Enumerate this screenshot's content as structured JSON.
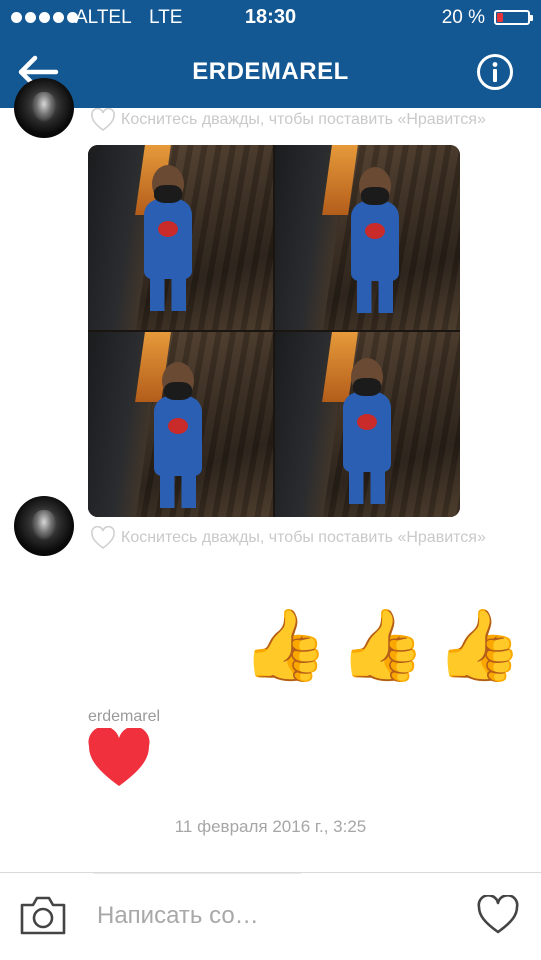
{
  "status_bar": {
    "carrier": "ALTEL",
    "network": "LTE",
    "time": "18:30",
    "battery_percent": "20 %",
    "battery_level": 0.2
  },
  "header": {
    "title": "ERDEMAREL",
    "back_icon": "arrow-left-icon",
    "info_icon": "info-circle-icon"
  },
  "messages": {
    "like_hint": "Коснитесь дважды, чтобы поставить «Нравится»",
    "reaction_emoji": [
      "👍",
      "👍",
      "👍"
    ],
    "sender_name": "erdemarel",
    "heart_icon": "heart-filled-icon",
    "timestamp": "11 февраля 2016 г., 3:25"
  },
  "composer": {
    "camera_icon": "camera-icon",
    "placeholder": "Написать со…",
    "value": "",
    "like_icon": "heart-outline-icon"
  },
  "colors": {
    "header_bg": "#135893",
    "heart_red": "#f0313d",
    "battery_red": "#e8323c"
  }
}
